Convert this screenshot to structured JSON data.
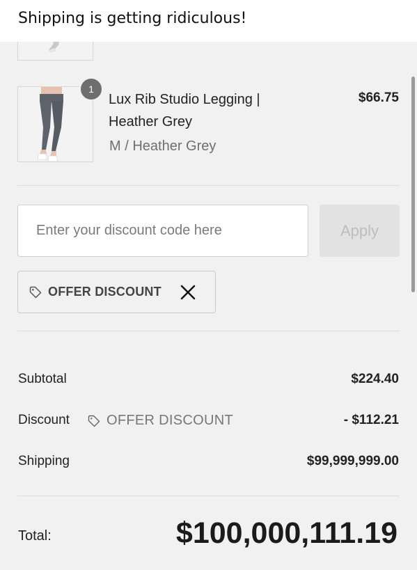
{
  "caption": "Shipping is getting ridiculous!",
  "cart": {
    "item": {
      "quantity": "1",
      "name": "Lux Rib Studio Legging | Heather Grey",
      "variant": "M / Heather Grey",
      "price": "$66.75"
    }
  },
  "discount": {
    "placeholder": "Enter your discount code here",
    "apply_label": "Apply",
    "applied_code": "OFFER DISCOUNT"
  },
  "summary": {
    "subtotal_label": "Subtotal",
    "subtotal_value": "$224.40",
    "discount_label": "Discount",
    "discount_code": "OFFER DISCOUNT",
    "discount_value": "- $112.21",
    "shipping_label": "Shipping",
    "shipping_value": "$99,999,999.00",
    "total_label": "Total:",
    "total_value": "$100,000,111.19"
  },
  "icons": {
    "tag": "tag-icon",
    "remove": "close-icon"
  },
  "colors": {
    "background": "#f1f1f1",
    "text": "#1b1b1b",
    "muted": "#777777",
    "badge": "#6e6e6e",
    "apply_disabled": "#e2e2e2"
  }
}
